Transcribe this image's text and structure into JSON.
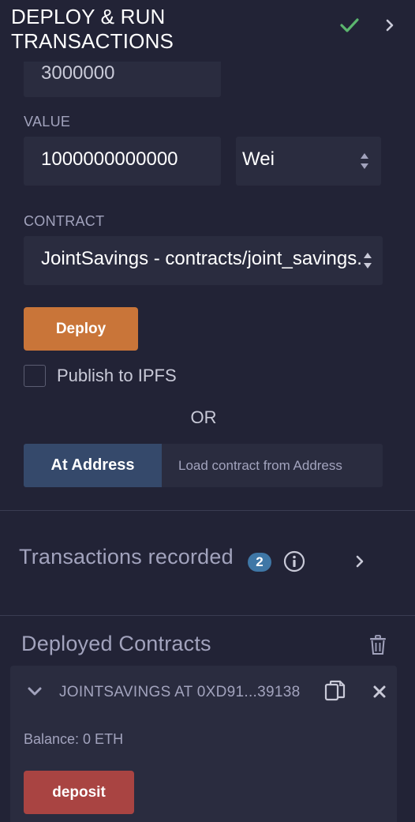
{
  "header": {
    "title": "DEPLOY & RUN TRANSACTIONS",
    "check_icon": "check-icon",
    "chevron_icon": "chevron-right-icon"
  },
  "gas_limit": {
    "value": "3000000"
  },
  "value_section": {
    "label": "VALUE",
    "amount": "1000000000000",
    "unit": "Wei"
  },
  "contract_section": {
    "label": "CONTRACT",
    "selected": "JointSavings - contracts/joint_savings.sol"
  },
  "deploy": {
    "label": "Deploy",
    "publish_label": "Publish to IPFS",
    "or_text": "OR",
    "at_address_label": "At Address",
    "address_placeholder": "Load contract from Address"
  },
  "transactions": {
    "label": "Transactions recorded",
    "count": "2"
  },
  "deployed": {
    "title": "Deployed Contracts",
    "instance_name": "JOINTSAVINGS AT 0XD91...39138 (",
    "balance": "Balance: 0 ETH",
    "deposit_label": "deposit"
  },
  "colors": {
    "background": "#222336",
    "field": "#2a2c3f",
    "deploy_button": "#c97539",
    "at_address_button": "#35496b",
    "deposit_button": "#a94442",
    "badge": "#3f77a6",
    "check": "#5bb56e"
  }
}
